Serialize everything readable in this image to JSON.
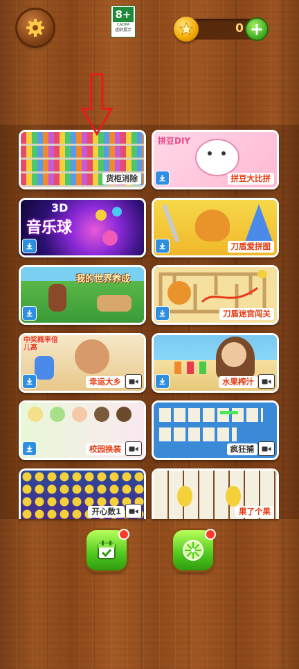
{
  "header": {
    "settings_icon": "gear-icon",
    "age_rating": {
      "value": "8+",
      "org": "CADPA",
      "tip": "适龄提示"
    },
    "coins": {
      "icon": "star-coin-icon",
      "count": "0",
      "add_icon": "plus-icon"
    }
  },
  "games": [
    {
      "label": "货柜消除",
      "action": "download"
    },
    {
      "label": "拼豆大比拼",
      "action": "download",
      "art_text": "拼豆DIY"
    },
    {
      "label": "",
      "action": "download",
      "art_text": "音乐球",
      "art_text_2": "3D"
    },
    {
      "label": "刀盾爱拼图",
      "action": "download"
    },
    {
      "label": "",
      "action": "download",
      "art_text": "我的世界养成"
    },
    {
      "label": "刀盾迷宫闯关",
      "action": "download"
    },
    {
      "label": "幸运大乡",
      "action": "video",
      "art_text": "中奖概率倍儿高"
    },
    {
      "label": "水果榨汁",
      "action": "video"
    },
    {
      "label": "校园换装",
      "action": "video"
    },
    {
      "label": "疯狂捕",
      "action": "video"
    },
    {
      "label": "开心数1",
      "action": "video"
    },
    {
      "label": "果了个果",
      "action": "none"
    }
  ],
  "bottom": {
    "left_icon": "calendar-check-icon",
    "right_icon": "lime-slice-icon"
  },
  "colors": {
    "label_red": "#e53a10",
    "download_blue": "#2e8fe0",
    "green_button": "#4ec81e"
  }
}
